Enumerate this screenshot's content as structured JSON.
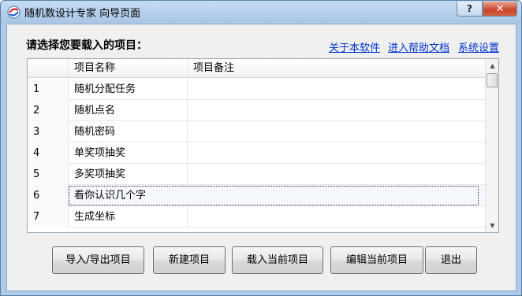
{
  "window": {
    "title": "随机数设计专家 向导页面",
    "help_label": "?",
    "close_label": "✕"
  },
  "prompt": "请选择您要载入的项目：",
  "links": {
    "about": "关于本软件",
    "help": "进入帮助文档",
    "settings": "系统设置"
  },
  "grid": {
    "columns": [
      "",
      "项目名称",
      "项目备注"
    ],
    "rows": [
      {
        "num": "1",
        "name": "随机分配任务",
        "note": ""
      },
      {
        "num": "2",
        "name": "随机点名",
        "note": ""
      },
      {
        "num": "3",
        "name": "随机密码",
        "note": ""
      },
      {
        "num": "4",
        "name": "单奖项抽奖",
        "note": ""
      },
      {
        "num": "5",
        "name": "多奖项抽奖",
        "note": ""
      },
      {
        "num": "6",
        "name": "看你认识几个字",
        "note": ""
      },
      {
        "num": "7",
        "name": "生成坐标",
        "note": ""
      }
    ],
    "selected_row": 6
  },
  "buttons": {
    "import_export": "导入/导出项目",
    "new": "新建项目",
    "load": "载入当前项目",
    "edit": "编辑当前项目",
    "exit": "退出"
  },
  "icons": {
    "app": "app-logo-icon",
    "scroll_up": "scroll-up-arrow-icon",
    "scroll_down": "scroll-down-arrow-icon"
  },
  "colors": {
    "link": "#0033cc",
    "close": "#c9452a",
    "titlebar": "#aecbe9"
  }
}
